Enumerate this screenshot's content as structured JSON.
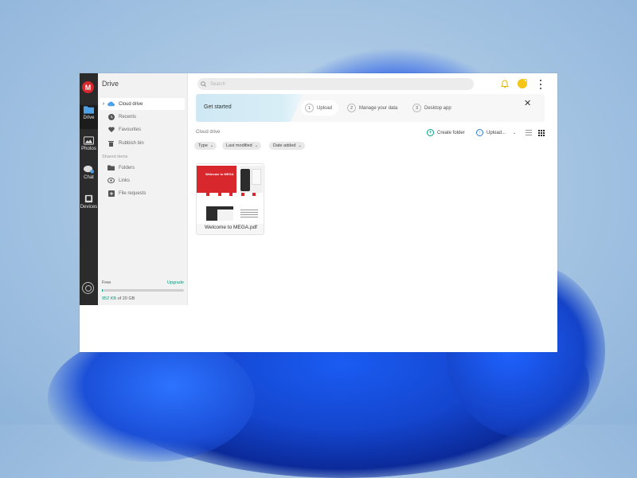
{
  "rail": {
    "logo": "M",
    "items": [
      {
        "label": "Drive",
        "icon": "folder-icon"
      },
      {
        "label": "Photos",
        "icon": "photos-icon"
      },
      {
        "label": "Chat",
        "icon": "chat-icon"
      },
      {
        "label": "Devices",
        "icon": "devices-icon"
      }
    ]
  },
  "sidebar": {
    "title": "Drive",
    "items": [
      {
        "label": "Cloud drive",
        "icon": "cloud-icon"
      },
      {
        "label": "Recents",
        "icon": "clock-icon"
      },
      {
        "label": "Favourites",
        "icon": "heart-icon"
      },
      {
        "label": "Rubbish bin",
        "icon": "trash-icon"
      }
    ],
    "shared_section": "Shared items",
    "shared_items": [
      {
        "label": "Folders",
        "icon": "shared-folder-icon"
      },
      {
        "label": "Links",
        "icon": "link-icon"
      },
      {
        "label": "File requests",
        "icon": "file-request-icon"
      }
    ],
    "storage": {
      "plan": "Free",
      "upgrade": "Upgrade",
      "used": "952 KB",
      "total_text": "of 20 GB",
      "used_fraction": 5e-05
    }
  },
  "header": {
    "search_placeholder": "Search"
  },
  "banner": {
    "title": "Get started",
    "steps": [
      {
        "num": "1",
        "label": "Upload"
      },
      {
        "num": "2",
        "label": "Manage your data"
      },
      {
        "num": "3",
        "label": "Desktop app"
      }
    ]
  },
  "content": {
    "breadcrumb": "Cloud drive",
    "create_folder": "Create folder",
    "upload": "Upload...",
    "filters": [
      "Type",
      "Last modified",
      "Date added"
    ],
    "files": [
      {
        "name": "Welcome to MEGA.pdf",
        "thumb_title": "Welcome to MEGA"
      }
    ]
  },
  "colors": {
    "brand_red": "#d9272e",
    "accent_green": "#00a382",
    "accent_blue": "#2b7bd8",
    "avatar": "#f5c518"
  }
}
